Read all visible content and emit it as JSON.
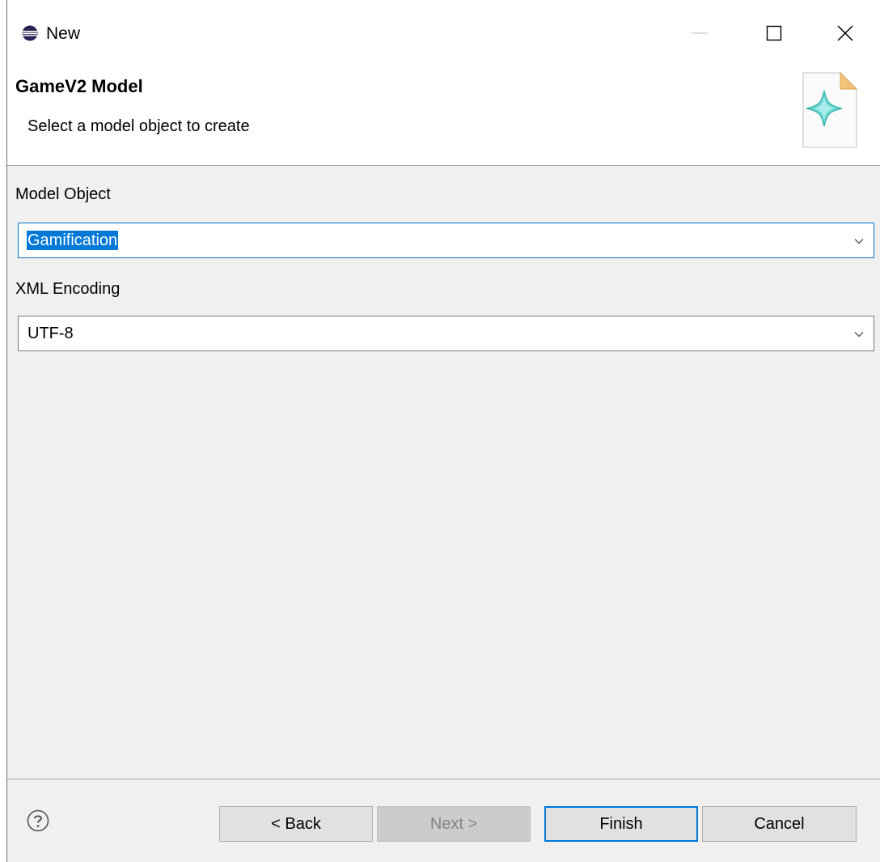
{
  "window": {
    "title": "New"
  },
  "banner": {
    "title": "GameV2 Model",
    "description": "Select a model object to create",
    "graphic_icon": "wizard-sparkle-icon"
  },
  "fields": {
    "model_object": {
      "label": "Model Object",
      "value": "Gamification"
    },
    "xml_encoding": {
      "label": "XML Encoding",
      "value": "UTF-8"
    }
  },
  "buttons": {
    "back": "< Back",
    "next": "Next >",
    "finish": "Finish",
    "cancel": "Cancel"
  },
  "colors": {
    "accent": "#0078d7",
    "dialog_background": "#f0f0f0",
    "disabled_button": "#cccccc"
  }
}
